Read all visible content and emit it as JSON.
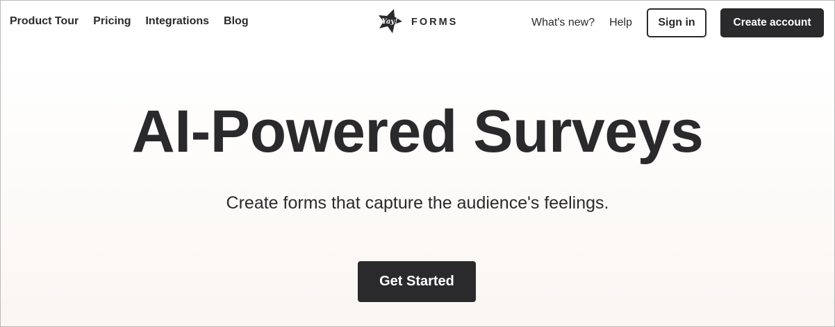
{
  "nav": {
    "links": [
      {
        "label": "Product Tour"
      },
      {
        "label": "Pricing"
      },
      {
        "label": "Integrations"
      },
      {
        "label": "Blog"
      }
    ],
    "logo": {
      "mark_text": "Yay!",
      "wordmark": "FORMS"
    },
    "whats_new": "What's new?",
    "help": "Help",
    "sign_in": "Sign in",
    "create_account": "Create account"
  },
  "hero": {
    "title": "AI-Powered Surveys",
    "subtitle": "Create forms that capture the audience's feelings.",
    "cta": "Get Started"
  },
  "colors": {
    "text": "#2a2a2c",
    "button_dark": "#2a2a2c",
    "background_bottom": "#faf6f2"
  }
}
